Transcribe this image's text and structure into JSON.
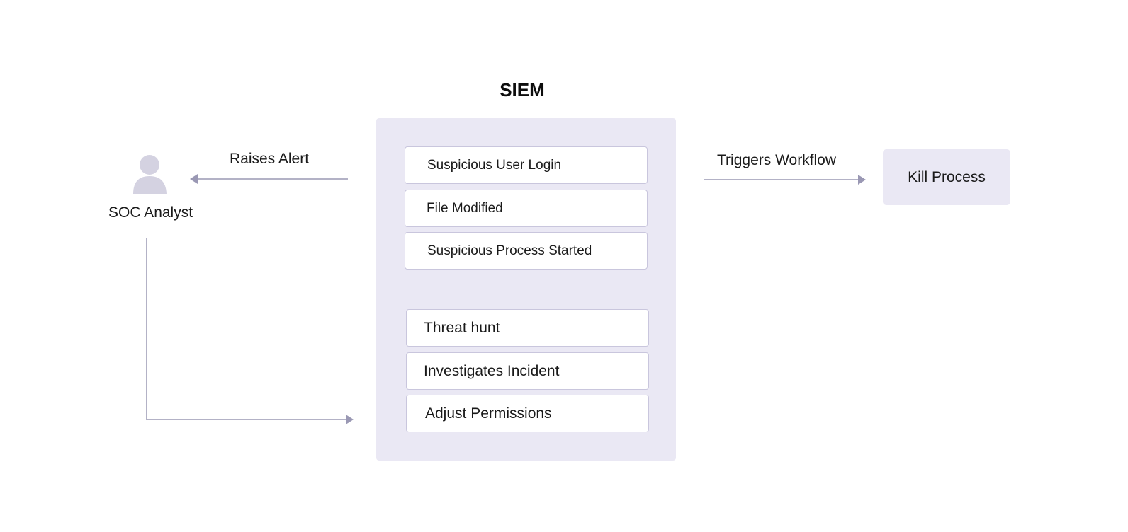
{
  "diagram": {
    "title": "SIEM",
    "actor": {
      "label": "SOC Analyst",
      "icon": "user-icon"
    },
    "edges": {
      "raises_alert": "Raises Alert",
      "triggers_workflow": "Triggers Workflow"
    },
    "siem_events": [
      "Suspicious User Login",
      "File Modified",
      "Suspicious Process Started"
    ],
    "analyst_actions": [
      "Threat hunt",
      "Investigates Incident",
      "Adjust Permissions"
    ],
    "workflow_action": "Kill Process",
    "colors": {
      "panel": "#eae8f4",
      "border": "#c9c6dd",
      "arrow": "#9a98b4",
      "icon": "#d4d2e1"
    }
  }
}
